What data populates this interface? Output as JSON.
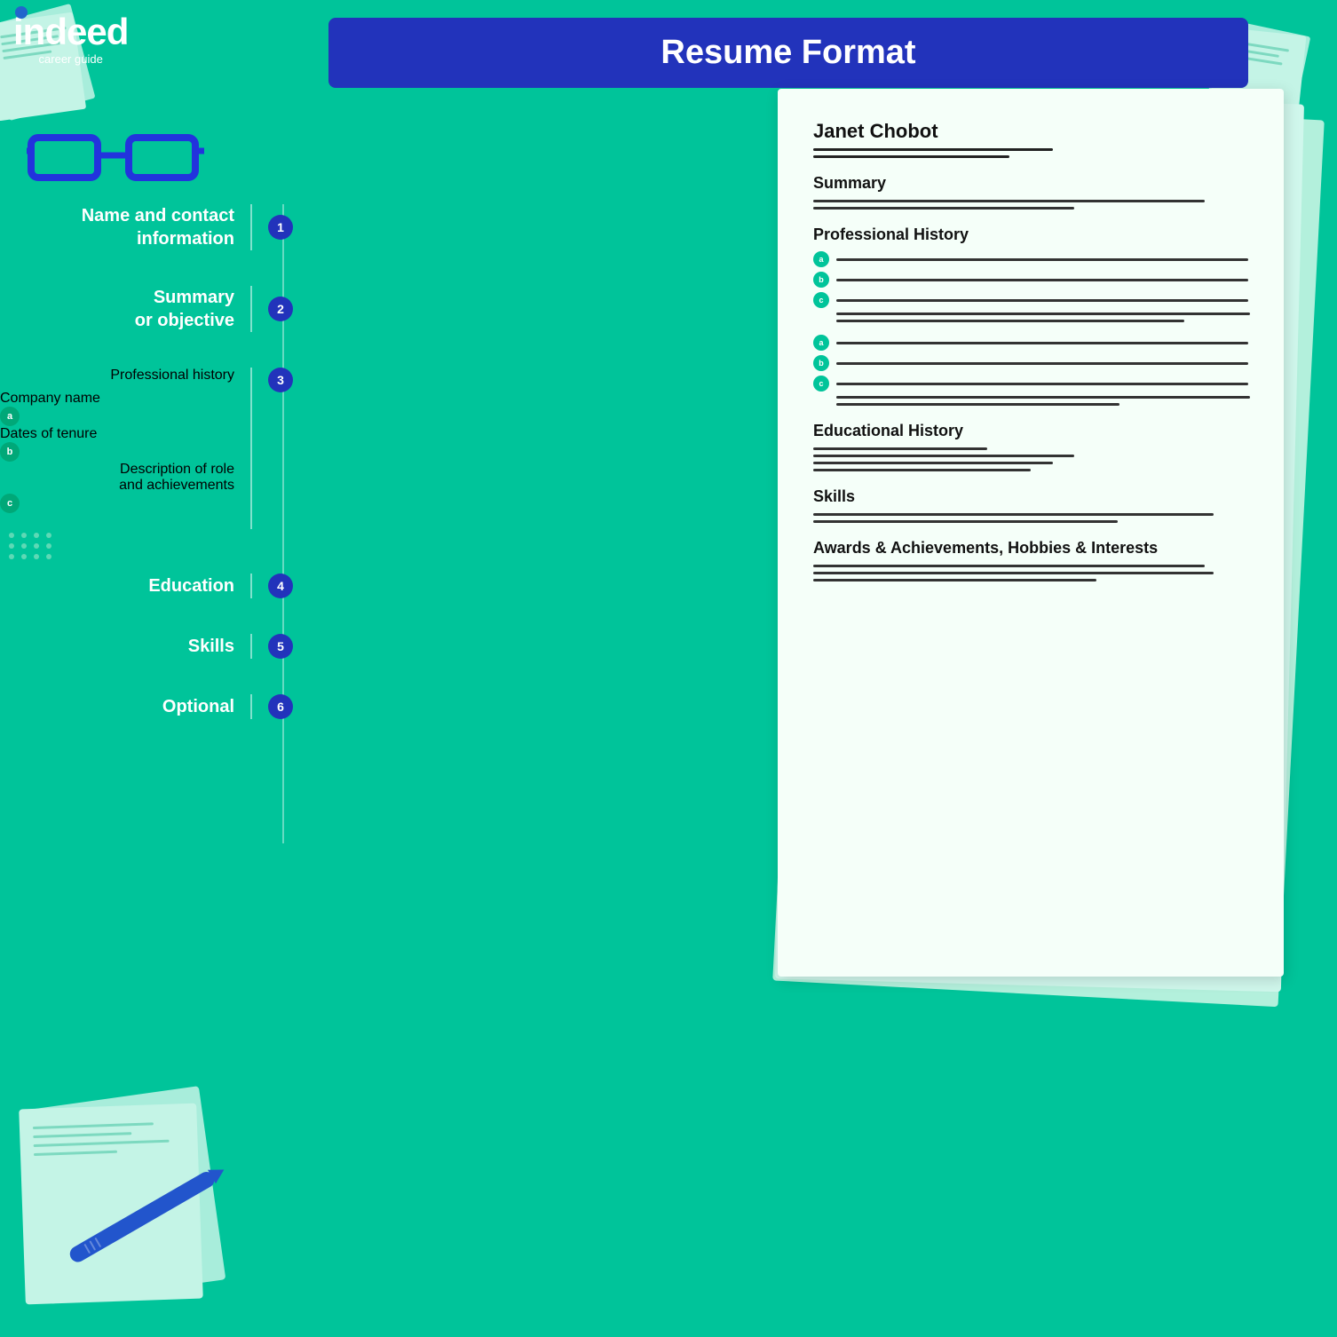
{
  "title": "Resume Format",
  "logo": {
    "brand": "indeed",
    "subtitle": "career guide"
  },
  "sidebar": {
    "items": [
      {
        "id": "name-contact",
        "label": "Name and contact\ninformation",
        "number": "1"
      },
      {
        "id": "summary",
        "label": "Summary\nor objective",
        "number": "2"
      },
      {
        "id": "professional-history",
        "label": "Professional history",
        "number": "3",
        "sub_items": [
          {
            "key": "a",
            "label": "Company name"
          },
          {
            "key": "b",
            "label": "Dates of tenure"
          },
          {
            "key": "c",
            "label": "Description of role\nand achievements"
          }
        ]
      },
      {
        "id": "education",
        "label": "Education",
        "number": "4"
      },
      {
        "id": "skills",
        "label": "Skills",
        "number": "5"
      },
      {
        "id": "optional",
        "label": "Optional",
        "number": "6"
      }
    ]
  },
  "resume": {
    "name": "Janet Chobot",
    "sections": [
      {
        "title": "Summary",
        "lines": [
          {
            "width": "90%"
          },
          {
            "width": "60%"
          }
        ]
      },
      {
        "title": "Professional History",
        "groups": [
          {
            "bullets": [
              {
                "key": "a",
                "width": "70%"
              },
              {
                "key": "b",
                "width": "95%"
              },
              {
                "key": "c",
                "width": "95%"
              }
            ],
            "extra_lines": [
              {
                "width": "80%"
              }
            ]
          },
          {
            "bullets": [
              {
                "key": "a",
                "width": "75%"
              },
              {
                "key": "b",
                "width": "95%"
              },
              {
                "key": "c",
                "width": "95%"
              }
            ],
            "extra_lines": [
              {
                "width": "65%"
              }
            ]
          }
        ]
      },
      {
        "title": "Educational History",
        "lines": [
          {
            "width": "40%"
          },
          {
            "width": "60%"
          },
          {
            "width": "55%"
          },
          {
            "width": "50%"
          }
        ]
      },
      {
        "title": "Skills",
        "lines": [
          {
            "width": "92%"
          },
          {
            "width": "70%"
          }
        ]
      },
      {
        "title": "Awards & Achievements, Hobbies & Interests",
        "lines": [
          {
            "width": "90%"
          },
          {
            "width": "92%"
          },
          {
            "width": "65%"
          }
        ]
      }
    ]
  }
}
